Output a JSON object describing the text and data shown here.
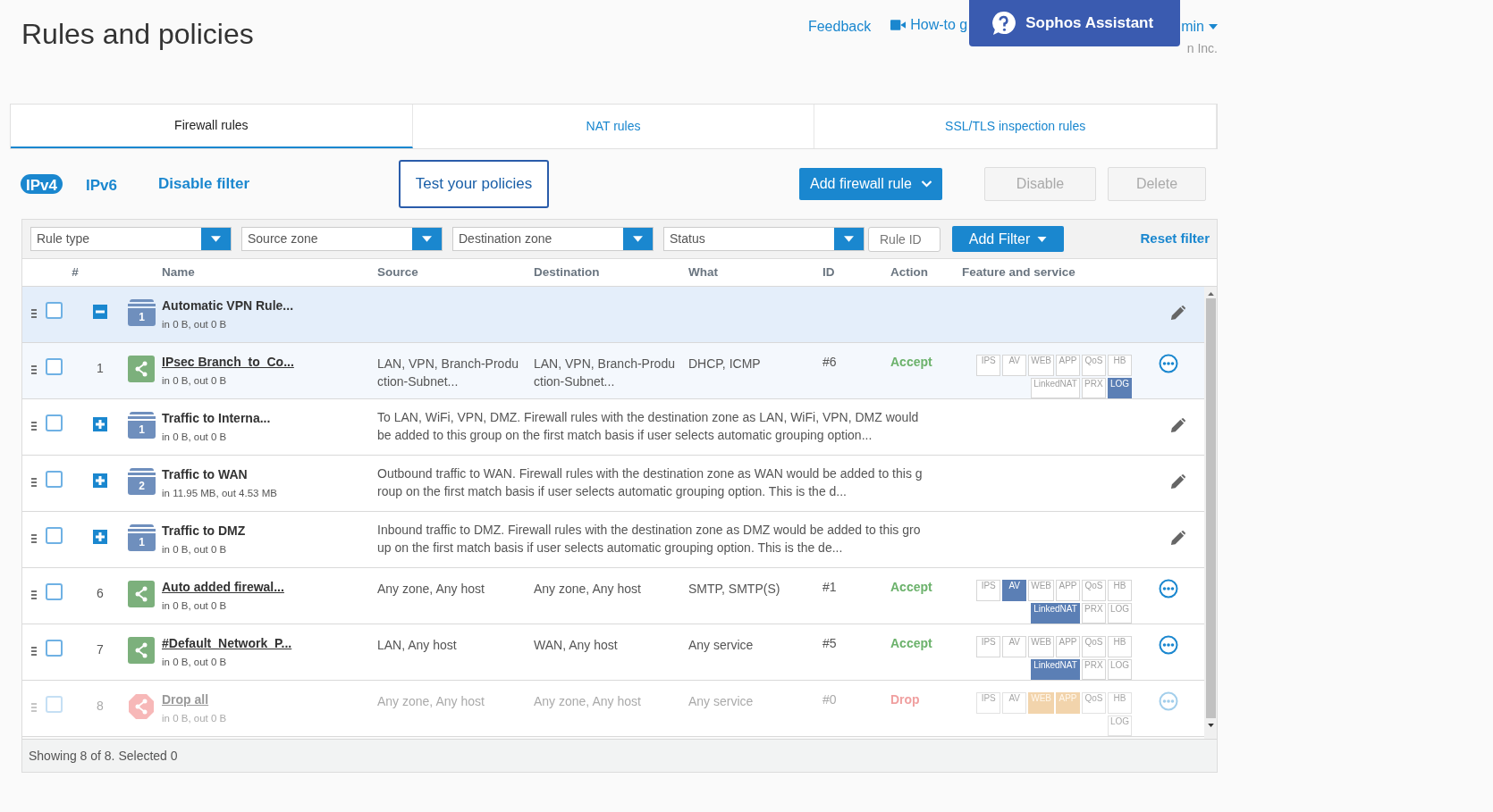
{
  "page": {
    "title": "Rules and policies"
  },
  "header": {
    "feedback": "Feedback",
    "howto": "How-to g",
    "assistant": "Sophos Assistant",
    "account": "min",
    "company": "n Inc."
  },
  "tabs": [
    {
      "label": "Firewall rules",
      "selected": true
    },
    {
      "label": "NAT rules",
      "selected": false
    },
    {
      "label": "SSL/TLS inspection rules",
      "selected": false
    }
  ],
  "ip_toggle": [
    {
      "label": "IPv4",
      "selected": true
    },
    {
      "label": "IPv6",
      "selected": false
    }
  ],
  "disable_filter": "Disable filter",
  "test_button": "Test your policies",
  "add_rule_button": "Add firewall rule",
  "disable_button": {
    "label": "Disable",
    "disabled": true
  },
  "delete_button": {
    "label": "Delete",
    "disabled": true
  },
  "filters": {
    "selects": [
      "Rule type",
      "Source zone",
      "Destination zone",
      "Status"
    ],
    "rule_id": {
      "placeholder": "Rule ID"
    },
    "add_filter": "Add Filter",
    "reset": "Reset filter"
  },
  "table": {
    "columns": [
      "#",
      "Name",
      "Source",
      "Destination",
      "What",
      "ID",
      "Action",
      "Feature and service"
    ],
    "rows": [
      {
        "kind": "group",
        "name": "Automatic VPN Rule...",
        "traffic": "in 0 B, out 0 B",
        "count": "1",
        "expanded": true,
        "checked": false,
        "children": [
          {
            "kind": "rule",
            "number": "1",
            "name": "IPsec Branch_to_Co...",
            "traffic": "in 0 B, out 0 B",
            "source": "LAN, VPN, Branch-Produ ction-Subnet...",
            "destination": "LAN, VPN, Branch-Produ ction-Subnet...",
            "what": "DHCP, ICMP",
            "id": "#6",
            "action": "Accept",
            "accepted": true,
            "disabled": false,
            "checked": false,
            "features": [
              {
                "label": "IPS",
                "on": false
              },
              {
                "label": "AV",
                "on": false
              },
              {
                "label": "WEB",
                "on": false
              },
              {
                "label": "APP",
                "on": false
              },
              {
                "label": "QoS",
                "on": false
              },
              {
                "label": "HB",
                "on": false
              },
              {
                "label": "LinkedNAT",
                "on": false
              },
              {
                "label": "PRX",
                "on": false
              },
              {
                "label": "LOG",
                "on": true,
                "color": "#5b7fb5"
              }
            ]
          }
        ]
      },
      {
        "kind": "group",
        "name": "Traffic to Interna...",
        "traffic": "in 0 B, out 0 B",
        "count": "1",
        "expanded": false,
        "checked": false,
        "description": "To LAN, WiFi, VPN, DMZ. Firewall rules with the destination zone as LAN, WiFi, VPN, DMZ would be added to this group on the first match basis if user selects automatic grouping option..."
      },
      {
        "kind": "group",
        "name": "Traffic to WAN",
        "traffic": "in 11.95 MB, out 4.53 MB",
        "count": "2",
        "expanded": false,
        "checked": false,
        "description": "Outbound traffic to WAN. Firewall rules with the destination zone as WAN would be added to this group on the first match basis if user selects automatic grouping option. This is the d..."
      },
      {
        "kind": "group",
        "name": "Traffic to DMZ",
        "traffic": "in 0 B, out 0 B",
        "count": "1",
        "expanded": false,
        "checked": false,
        "description": "Inbound traffic to DMZ. Firewall rules with the destination zone as DMZ would be added to this group on the first match basis if user selects automatic grouping option. This is the de..."
      },
      {
        "kind": "rule",
        "number": "6",
        "name": "Auto added firewal...",
        "traffic": "in 0 B, out 0 B",
        "source": "Any zone, Any host",
        "destination": "Any zone, Any host",
        "what": "SMTP, SMTP(S)",
        "id": "#1",
        "action": "Accept",
        "accepted": true,
        "disabled": false,
        "checked": false,
        "features": [
          {
            "label": "IPS",
            "on": false
          },
          {
            "label": "AV",
            "on": true,
            "color": "#5b7fb5"
          },
          {
            "label": "WEB",
            "on": false
          },
          {
            "label": "APP",
            "on": false
          },
          {
            "label": "QoS",
            "on": false
          },
          {
            "label": "HB",
            "on": false
          },
          {
            "label": "LinkedNAT",
            "on": true,
            "color": "#5b7fb5"
          },
          {
            "label": "PRX",
            "on": false
          },
          {
            "label": "LOG",
            "on": false
          }
        ]
      },
      {
        "kind": "rule",
        "number": "7",
        "name": "#Default_Network_P...",
        "traffic": "in 0 B, out 0 B",
        "source": "LAN, Any host",
        "destination": "WAN, Any host",
        "what": "Any service",
        "id": "#5",
        "action": "Accept",
        "accepted": true,
        "disabled": false,
        "checked": false,
        "features": [
          {
            "label": "IPS",
            "on": false
          },
          {
            "label": "AV",
            "on": false
          },
          {
            "label": "WEB",
            "on": false
          },
          {
            "label": "APP",
            "on": false
          },
          {
            "label": "QoS",
            "on": false
          },
          {
            "label": "HB",
            "on": false
          },
          {
            "label": "LinkedNAT",
            "on": true,
            "color": "#5b7fb5"
          },
          {
            "label": "PRX",
            "on": false
          },
          {
            "label": "LOG",
            "on": false
          }
        ]
      },
      {
        "kind": "rule",
        "number": "8",
        "name": "Drop all",
        "traffic": "in 0 B, out 0 B",
        "source": "Any zone, Any host",
        "destination": "Any zone, Any host",
        "what": "Any service",
        "id": "#0",
        "action": "Drop",
        "accepted": false,
        "disabled": true,
        "checked": false,
        "features": [
          {
            "label": "IPS",
            "on": false
          },
          {
            "label": "AV",
            "on": false
          },
          {
            "label": "WEB",
            "on": true,
            "color": "#f2d4ac"
          },
          {
            "label": "APP",
            "on": true,
            "color": "#f2d4ac"
          },
          {
            "label": "QoS",
            "on": false
          },
          {
            "label": "HB",
            "on": false
          },
          {
            "label": "LOG",
            "on": false
          }
        ]
      }
    ]
  },
  "status_bar": "Showing 8 of 8. Selected 0"
}
